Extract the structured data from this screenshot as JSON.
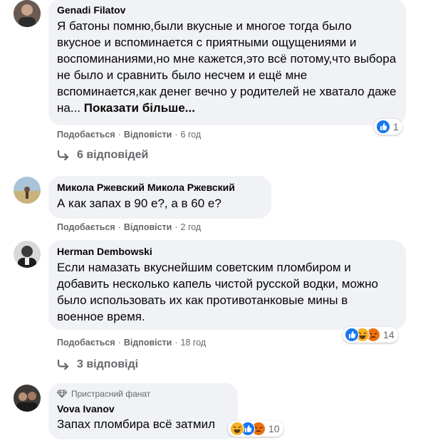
{
  "actions": {
    "like": "Подобається",
    "reply": "Відповісти",
    "sep": "·"
  },
  "comments": [
    {
      "author": "Genadi Filatov",
      "text": "Я батоны помню,были вкусные и многое тогда было вкусное и вспоминается с приятными ощущениями и воспоминаниями,но мне кажется,это всё потому,что выбора не было и сравнить было несчем и ещё мне вспоминается,как денег вечно у родителей не хватало даже на...",
      "see_more": "Показати більше...",
      "time": "6 год",
      "reactions": {
        "icons": [
          "like-icon"
        ],
        "count": "1"
      },
      "replies": "6 відповідей"
    },
    {
      "author": "Микола Ржевский Микола Ржевский",
      "text": "А как запах в 90 е?, а в 60 е?",
      "time": "2 год"
    },
    {
      "author": "Herman Dembowski",
      "text": "Если намазать вкуснейшим советским пломбиром и добавить несколько капель чистой русской водки, можно было использовать их как противотанковые мины в военное время.",
      "time": "18 год",
      "reactions": {
        "icons": [
          "like-icon",
          "haha-icon",
          "angry-icon"
        ],
        "count": "14"
      },
      "replies": "3 відповіді"
    },
    {
      "badge": "Пристрасний фанат",
      "author": "Vova Ivanov",
      "text": "Запах пломбира всё затмил",
      "reactions": {
        "icons": [
          "haha-icon",
          "like-icon",
          "angry-icon"
        ],
        "count": "10"
      }
    }
  ],
  "colors": {
    "like": "#1877f2",
    "haha": "#f7b125",
    "angry": "#e9710f",
    "bubble": "#f0f2f5",
    "meta": "#65676b"
  }
}
